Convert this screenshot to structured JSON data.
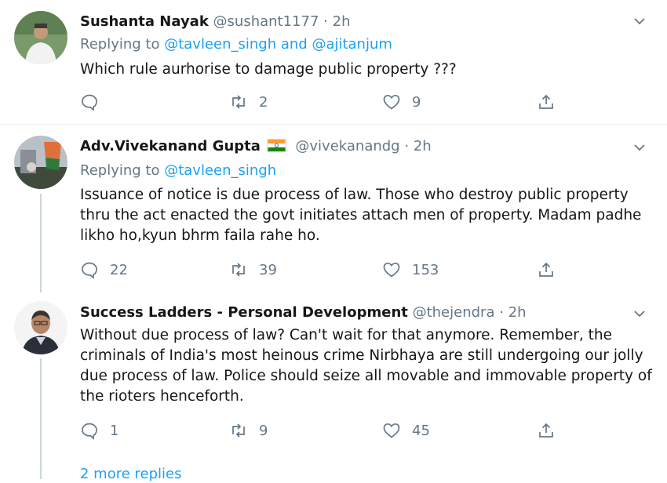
{
  "colors": {
    "link": "#1da1f2",
    "muted": "#657786",
    "text": "#14171a",
    "divider": "#e6ecf0"
  },
  "tweets": [
    {
      "name": "Sushanta Nayak",
      "handle": "@sushant1177",
      "dot": "·",
      "time": "2h",
      "replying_prefix": "Replying to ",
      "mention_1": "@tavleen_singh",
      "and": " and ",
      "mention_2": "@ajitanjum",
      "text": "Which rule aurhorise to damage public property ???",
      "reply_count": "",
      "retweet_count": "2",
      "like_count": "9"
    },
    {
      "name": "Adv.Vivekanand Gupta",
      "flag_icon": "india-flag-icon",
      "handle": "@vivekanandg",
      "dot": "·",
      "time": "2h",
      "replying_prefix": "Replying to ",
      "mention_1": "@tavleen_singh",
      "text": "Issuance of notice is due process of law. Those who destroy public property thru the act enacted the govt initiates attach men of property. Madam padhe likho ho,kyun bhrm faila rahe ho.",
      "reply_count": "22",
      "retweet_count": "39",
      "like_count": "153"
    },
    {
      "name": "Success Ladders - Personal Development",
      "handle": "@thejendra",
      "dot": "·",
      "time": "2h",
      "text": "Without due process of law? Can't wait for that anymore. Remember, the criminals of India's most heinous crime Nirbhaya are still undergoing our jolly due process of law. Police should seize all movable and immovable property of the rioters henceforth.",
      "reply_count": "1",
      "retweet_count": "9",
      "like_count": "45"
    }
  ],
  "more_replies": "2 more replies"
}
